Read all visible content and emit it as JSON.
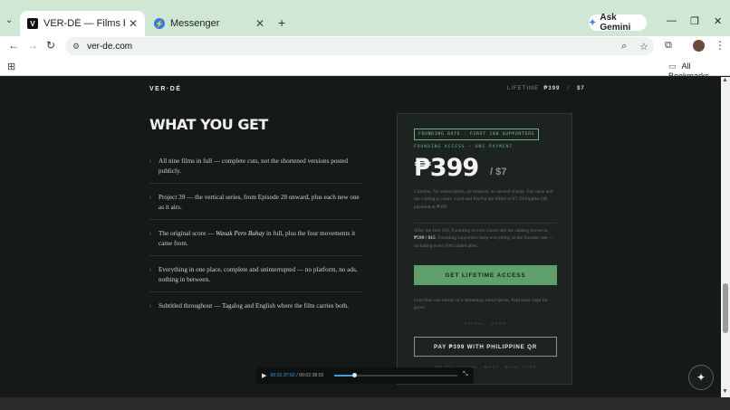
{
  "browser": {
    "tabs": [
      {
        "title": "VER-DÉ — Films by Green Ralph",
        "active": true
      },
      {
        "title": "Messenger",
        "active": false
      }
    ],
    "gemini_label": "Ask Gemini",
    "url": "ver-de.com",
    "bookmarks_label": "All Bookmarks"
  },
  "site": {
    "logo": "VER·DÉ",
    "nav_price_label": "LIFETIME",
    "nav_price_php": "₱399",
    "nav_price_sep": "/",
    "nav_price_usd": "$7"
  },
  "main": {
    "heading": "WHAT YOU GET",
    "features": [
      {
        "text_before": "All nine films in full — complete cuts, not the shortened versions posted publicly.",
        "italic": "",
        "text_after": ""
      },
      {
        "text_before": "Project 39 — the vertical series, from Episode 28 onward, plus each new one as it airs.",
        "italic": "",
        "text_after": ""
      },
      {
        "text_before": "The original score — ",
        "italic": "Wasak Pero Buhay",
        "text_after": " in full, plus the four movements it came from."
      },
      {
        "text_before": "Everything in one place, complete and uninterrupted — no platform, no ads, nothing in between.",
        "italic": "",
        "text_after": ""
      },
      {
        "text_before": "Subtitled throughout — Tagalog and English where the film carries both.",
        "italic": "",
        "text_after": ""
      }
    ]
  },
  "card": {
    "badge": "FOUNDING RATE · FIRST 100 SUPPORTERS",
    "founding_label": "FOUNDING ACCESS — ONE PAYMENT",
    "price_php": "₱399",
    "price_usd": "/ $7",
    "desc1": "Lifetime. No subscription, no renewal, no second charge. Pay once and the catalog is yours. Card and PayPal are billed at $7; Philippine QR payment at ₱399.",
    "desc2_before": "After the first 100, Founding Access closes and the catalog moves to ",
    "desc2_bold": "₱599 / $15",
    "desc2_after": ". Founding supporters keep everything at the founder rate — including every film added after.",
    "cta_label": "GET LIFETIME ACCESS",
    "desc3": "Less than one month of a streaming subscription. Paid once, kept for good.",
    "pay_methods": "PAYPAL · CARD",
    "qr_label": "PAY ₱399 WITH PHILIPPINE QR",
    "wallets": "QR PH · GCASH · MAYA · BANK APPS"
  },
  "player": {
    "current": "00:02:37:02",
    "sep": "/",
    "total": "00:02:38:02",
    "progress": 0.16
  }
}
